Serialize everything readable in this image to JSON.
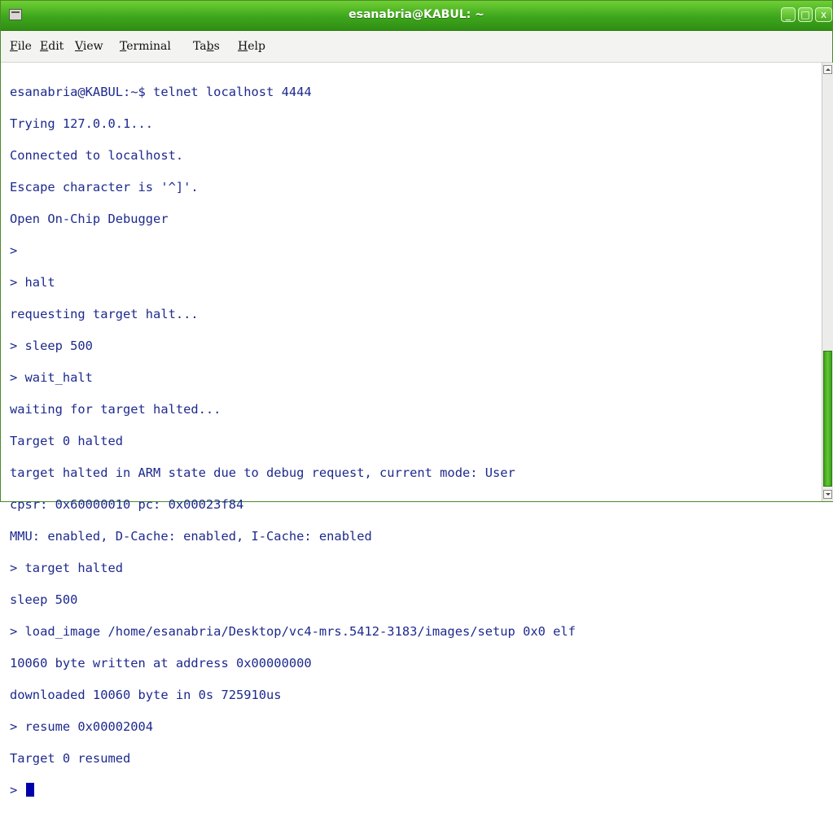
{
  "window": {
    "title": "esanabria@KABUL: ~",
    "buttons": {
      "minimize": "_",
      "maximize": "□",
      "close": "x"
    }
  },
  "menu": [
    {
      "pre": "",
      "u": "F",
      "post": "ile"
    },
    {
      "pre": "",
      "u": "E",
      "post": "dit"
    },
    {
      "pre": "",
      "u": "V",
      "post": "iew"
    },
    {
      "pre": "",
      "u": "T",
      "post": "erminal"
    },
    {
      "pre": "Ta",
      "u": "b",
      "post": "s"
    },
    {
      "pre": "",
      "u": "H",
      "post": "elp"
    }
  ],
  "terminal": {
    "lines": [
      "esanabria@KABUL:~$ telnet localhost 4444",
      "Trying 127.0.0.1...",
      "Connected to localhost.",
      "Escape character is '^]'.",
      "Open On-Chip Debugger",
      ">",
      "> halt",
      "requesting target halt...",
      "> sleep 500",
      "> wait_halt",
      "waiting for target halted...",
      "Target 0 halted",
      "target halted in ARM state due to debug request, current mode: User",
      "cpsr: 0x60000010 pc: 0x00023f84",
      "MMU: enabled, D-Cache: enabled, I-Cache: enabled",
      "> target halted",
      "sleep 500",
      "> load_image /home/esanabria/Desktop/vc4-mrs.5412-3183/images/setup 0x0 elf",
      "10060 byte written at address 0x00000000",
      "downloaded 10060 byte in 0s 725910us",
      "> resume 0x00002004",
      "Target 0 resumed",
      "> "
    ]
  },
  "colors": {
    "titlebar": "#4cb422",
    "terminal_text": "#1d2a8e",
    "cursor": "#0000aa"
  }
}
